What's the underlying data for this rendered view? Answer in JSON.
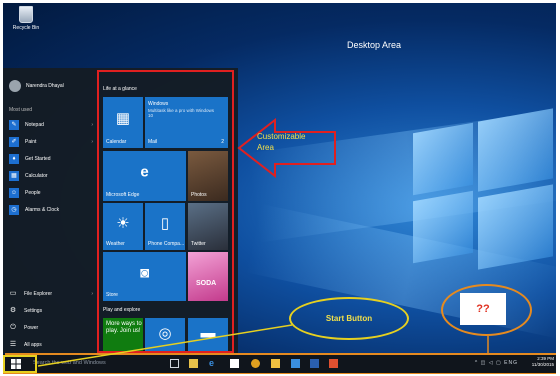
{
  "desktop": {
    "recycle_bin_label": "Recycle Bin",
    "area_label": "Desktop Area"
  },
  "start_menu": {
    "user_name": "Narendra Dhayal",
    "most_used_label": "Most used",
    "apps": [
      {
        "label": "Notepad",
        "icon": "notepad-icon",
        "has_arrow": true
      },
      {
        "label": "Paint",
        "icon": "paint-icon",
        "has_arrow": true
      },
      {
        "label": "Get Started",
        "icon": "get-started-icon",
        "has_arrow": false
      },
      {
        "label": "Calculator",
        "icon": "calculator-icon",
        "has_arrow": false
      },
      {
        "label": "People",
        "icon": "people-icon",
        "has_arrow": false
      },
      {
        "label": "Alarms & Clock",
        "icon": "alarm-icon",
        "has_arrow": false
      }
    ],
    "bottom": {
      "file_explorer": "File Explorer",
      "settings": "Settings",
      "power": "Power",
      "all_apps": "All apps"
    },
    "tiles": {
      "group1_label": "Life at a glance",
      "group2_label": "Play and explore",
      "calendar": "Calendar",
      "mail_title": "Windows",
      "mail_text": "Multitask like a pro with Windows 10",
      "mail": "Mail",
      "mail_count": "2",
      "edge": "Microsoft Edge",
      "photos": "Photos",
      "weather": "Weather",
      "phone": "Phone Compa...",
      "twitter": "Twitter",
      "store": "Store",
      "candy": "SODA",
      "xbox_text": "More ways to play. Join us!"
    }
  },
  "annotations": {
    "customizable_line1": "Customizable",
    "customizable_line2": "Area",
    "start_button": "Start Button",
    "question": "??"
  },
  "taskbar": {
    "search_placeholder": "Search the web and Windows",
    "language": "ENG",
    "time": "2:39 PM",
    "date": "11/30/2015"
  },
  "colors": {
    "red_outline": "#e02020",
    "yellow_outline": "#e6d020",
    "orange_outline": "#e58a20",
    "tile_blue": "#1a73c8"
  }
}
